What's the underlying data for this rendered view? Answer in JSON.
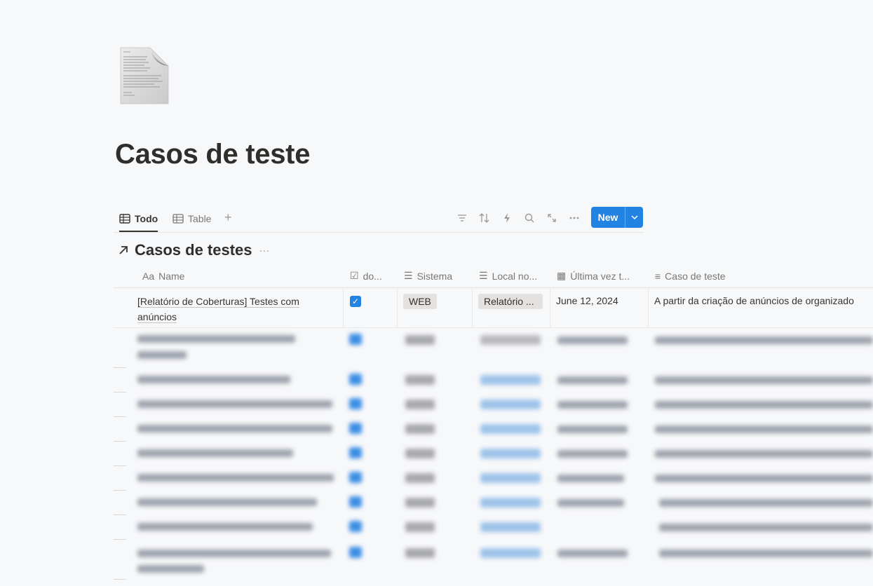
{
  "page": {
    "title": "Casos de teste",
    "icon": "document-page-icon"
  },
  "views": {
    "tabs": [
      {
        "label": "Todo",
        "icon": "table-icon",
        "active": true
      },
      {
        "label": "Table",
        "icon": "table-icon",
        "active": false
      }
    ],
    "add_view": "+"
  },
  "toolbar": {
    "icons": [
      "filter-icon",
      "sort-icon",
      "automation-icon",
      "search-icon",
      "expand-icon",
      "more-icon"
    ],
    "new_label": "New"
  },
  "database": {
    "title": "Casos de testes",
    "more": "···"
  },
  "columns": [
    {
      "icon_text": "Aa",
      "label": "Name"
    },
    {
      "icon_text": "☑",
      "label": "do..."
    },
    {
      "icon_text": "☰",
      "label": "Sistema"
    },
    {
      "icon_text": "☰",
      "label": "Local no..."
    },
    {
      "icon_text": "▦",
      "label": "Última vez t..."
    },
    {
      "icon_text": "≡",
      "label": "Caso de teste"
    }
  ],
  "rows": [
    {
      "name": "[Relatório de Coberturas] Testes com anúncios",
      "done": true,
      "sistema": "WEB",
      "local": "Relatório ...",
      "date": "June 12, 2024",
      "caso": "A partir da criação de anúncios de organizado"
    }
  ],
  "colors": {
    "accent": "#2383e2",
    "text": "#37352f",
    "muted": "#787774",
    "background": "#f7f8fa"
  }
}
